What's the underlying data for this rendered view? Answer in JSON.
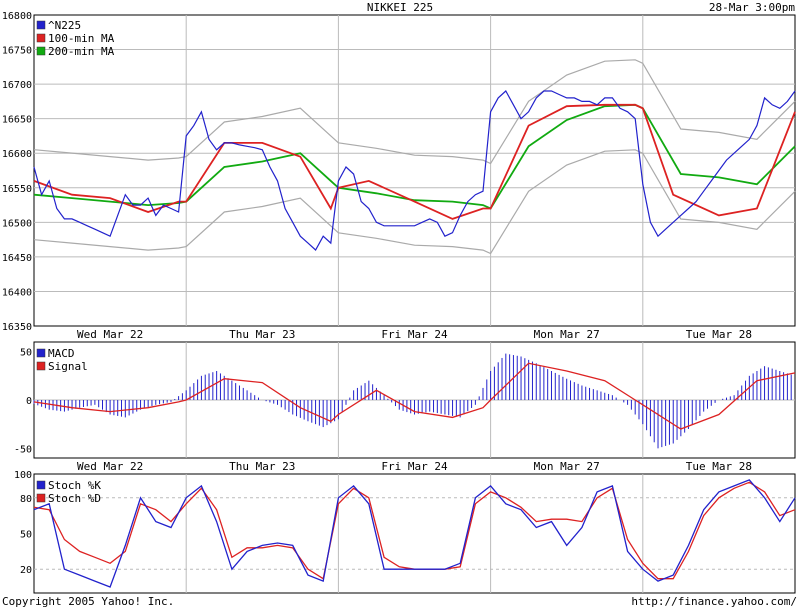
{
  "header": {
    "title": "NIKKEI 225",
    "timestamp": "28-Mar 3:00pm"
  },
  "footer": {
    "copyright": "Copyright 2005 Yahoo! Inc.",
    "url": "http://finance.yahoo.com/"
  },
  "colors": {
    "price": "#2222cc",
    "ma100": "#dd2222",
    "ma200": "#11aa11",
    "bands": "#aaaaaa",
    "grid": "#bbbbbb",
    "macd": "#2222cc",
    "signal": "#dd2222",
    "stochK": "#2222cc",
    "stochD": "#dd2222"
  },
  "chart_data": [
    {
      "type": "line",
      "panel": "price",
      "days": [
        "Wed Mar 22",
        "Thu Mar 23",
        "Fri Mar 24",
        "Mon Mar 27",
        "Tue Mar 28"
      ],
      "ylim": [
        16350,
        16800
      ],
      "yticks": [
        16350,
        16400,
        16450,
        16500,
        16550,
        16600,
        16650,
        16700,
        16750,
        16800
      ],
      "grid": true,
      "legend_position": "top-left",
      "legend": [
        "^N225",
        "100-min MA",
        "200-min MA"
      ],
      "series": [
        {
          "name": "^N225",
          "x": [
            0,
            0.05,
            0.1,
            0.15,
            0.2,
            0.25,
            0.3,
            0.35,
            0.4,
            0.45,
            0.5,
            0.55,
            0.6,
            0.65,
            0.7,
            0.75,
            0.8,
            0.85,
            0.9,
            0.95,
            1.0,
            1.05,
            1.1,
            1.15,
            1.2,
            1.25,
            1.3,
            1.35,
            1.4,
            1.45,
            1.5,
            1.55,
            1.6,
            1.65,
            1.7,
            1.75,
            1.8,
            1.85,
            1.9,
            1.95,
            2.0,
            2.05,
            2.1,
            2.15,
            2.2,
            2.25,
            2.3,
            2.35,
            2.4,
            2.45,
            2.5,
            2.55,
            2.6,
            2.65,
            2.7,
            2.75,
            2.8,
            2.85,
            2.9,
            2.95,
            3.0,
            3.05,
            3.1,
            3.15,
            3.2,
            3.25,
            3.3,
            3.35,
            3.4,
            3.45,
            3.5,
            3.55,
            3.6,
            3.65,
            3.7,
            3.75,
            3.8,
            3.85,
            3.9,
            3.95,
            4.0,
            4.05,
            4.1,
            4.15,
            4.2,
            4.25,
            4.3,
            4.35,
            4.4,
            4.45,
            4.5,
            4.55,
            4.6,
            4.65,
            4.7,
            4.75,
            4.8,
            4.85,
            4.9,
            4.95,
            5.0
          ],
          "values": [
            16580,
            16540,
            16560,
            16520,
            16505,
            16505,
            16500,
            16495,
            16490,
            16485,
            16480,
            16510,
            16540,
            16525,
            16525,
            16535,
            16510,
            16525,
            16520,
            16515,
            16625,
            16640,
            16660,
            16620,
            16605,
            16615,
            16615,
            16612,
            16610,
            16608,
            16605,
            16580,
            16560,
            16520,
            16500,
            16480,
            16470,
            16460,
            16480,
            16470,
            16560,
            16580,
            16570,
            16530,
            16520,
            16500,
            16495,
            16495,
            16495,
            16495,
            16495,
            16500,
            16505,
            16500,
            16480,
            16485,
            16510,
            16530,
            16540,
            16545,
            16660,
            16680,
            16690,
            16670,
            16650,
            16660,
            16680,
            16690,
            16690,
            16685,
            16680,
            16680,
            16675,
            16675,
            16670,
            16680,
            16680,
            16665,
            16660,
            16650,
            16555,
            16500,
            16480,
            16490,
            16500,
            16510,
            16520,
            16530,
            16545,
            16560,
            16575,
            16590,
            16600,
            16610,
            16620,
            16640,
            16680,
            16670,
            16665,
            16675,
            16690
          ]
        },
        {
          "name": "100-min MA",
          "x": [
            0,
            0.25,
            0.5,
            0.75,
            0.95,
            1.0,
            1.25,
            1.5,
            1.75,
            1.95,
            2.0,
            2.2,
            2.5,
            2.75,
            2.95,
            3.0,
            3.25,
            3.5,
            3.75,
            3.95,
            4.0,
            4.2,
            4.5,
            4.75,
            5.0
          ],
          "values": [
            16560,
            16540,
            16535,
            16515,
            16530,
            16530,
            16615,
            16615,
            16595,
            16520,
            16550,
            16560,
            16530,
            16505,
            16520,
            16520,
            16640,
            16668,
            16670,
            16670,
            16665,
            16540,
            16510,
            16520,
            16660
          ]
        },
        {
          "name": "200-min MA",
          "x": [
            0,
            0.25,
            0.5,
            0.75,
            0.95,
            1.0,
            1.25,
            1.5,
            1.75,
            1.95,
            2.0,
            2.25,
            2.5,
            2.75,
            2.95,
            3.0,
            3.25,
            3.5,
            3.75,
            3.95,
            4.0,
            4.25,
            4.5,
            4.75,
            5.0
          ],
          "values": [
            16540,
            16535,
            16530,
            16525,
            16528,
            16530,
            16580,
            16588,
            16600,
            16560,
            16550,
            16542,
            16532,
            16530,
            16525,
            16520,
            16610,
            16648,
            16668,
            16670,
            16665,
            16570,
            16565,
            16555,
            16610
          ]
        }
      ]
    },
    {
      "type": "bar",
      "panel": "macd",
      "ylim": [
        -60,
        60
      ],
      "yticks": [
        -50,
        0,
        50
      ],
      "legend": [
        "MACD",
        "Signal"
      ],
      "series": [
        {
          "name": "MACD",
          "x": [
            0,
            0.1,
            0.2,
            0.3,
            0.4,
            0.5,
            0.6,
            0.7,
            0.8,
            0.9,
            1.0,
            1.1,
            1.2,
            1.3,
            1.4,
            1.5,
            1.6,
            1.7,
            1.8,
            1.9,
            2.0,
            2.1,
            2.2,
            2.3,
            2.4,
            2.5,
            2.6,
            2.7,
            2.8,
            2.9,
            3.0,
            3.1,
            3.2,
            3.3,
            3.4,
            3.5,
            3.6,
            3.7,
            3.8,
            3.9,
            4.0,
            4.1,
            4.2,
            4.3,
            4.4,
            4.5,
            4.6,
            4.7,
            4.8,
            4.9,
            5.0
          ],
          "values": [
            -4,
            -10,
            -12,
            -8,
            -5,
            -15,
            -18,
            -10,
            -5,
            -2,
            10,
            25,
            30,
            20,
            10,
            0,
            -5,
            -15,
            -22,
            -28,
            -20,
            10,
            20,
            5,
            -10,
            -15,
            -12,
            -15,
            -18,
            -5,
            30,
            48,
            45,
            38,
            30,
            22,
            15,
            10,
            5,
            -5,
            -25,
            -50,
            -45,
            -30,
            -12,
            0,
            5,
            25,
            35,
            30,
            25
          ]
        },
        {
          "name": "Signal",
          "x": [
            0,
            0.25,
            0.5,
            0.75,
            0.95,
            1.0,
            1.25,
            1.5,
            1.75,
            1.95,
            2.0,
            2.25,
            2.5,
            2.75,
            2.95,
            3.0,
            3.25,
            3.5,
            3.75,
            3.95,
            4.0,
            4.25,
            4.5,
            4.75,
            5.0
          ],
          "values": [
            -2,
            -8,
            -12,
            -8,
            -2,
            0,
            22,
            18,
            -8,
            -22,
            -15,
            10,
            -12,
            -18,
            -8,
            0,
            38,
            30,
            20,
            0,
            -5,
            -30,
            -15,
            20,
            28
          ]
        }
      ]
    },
    {
      "type": "line",
      "panel": "stochastic",
      "ylim": [
        0,
        100
      ],
      "yticks": [
        20,
        50,
        80,
        100
      ],
      "legend": [
        "Stoch %K",
        "Stoch %D"
      ],
      "series": [
        {
          "name": "Stoch %K",
          "x": [
            0,
            0.1,
            0.2,
            0.3,
            0.4,
            0.5,
            0.6,
            0.7,
            0.8,
            0.9,
            1.0,
            1.1,
            1.2,
            1.3,
            1.4,
            1.5,
            1.6,
            1.7,
            1.8,
            1.9,
            2.0,
            2.1,
            2.2,
            2.3,
            2.4,
            2.5,
            2.6,
            2.7,
            2.8,
            2.9,
            3.0,
            3.1,
            3.2,
            3.3,
            3.4,
            3.5,
            3.6,
            3.7,
            3.8,
            3.9,
            4.0,
            4.1,
            4.2,
            4.3,
            4.4,
            4.5,
            4.6,
            4.7,
            4.8,
            4.9,
            5.0
          ],
          "values": [
            70,
            75,
            20,
            15,
            10,
            5,
            40,
            80,
            60,
            55,
            80,
            90,
            60,
            20,
            35,
            40,
            42,
            40,
            15,
            10,
            80,
            90,
            75,
            20,
            20,
            20,
            20,
            20,
            25,
            80,
            90,
            75,
            70,
            55,
            60,
            40,
            55,
            85,
            90,
            35,
            20,
            10,
            15,
            40,
            70,
            85,
            90,
            95,
            80,
            60,
            80
          ]
        },
        {
          "name": "Stoch %D",
          "x": [
            0,
            0.1,
            0.2,
            0.3,
            0.4,
            0.5,
            0.6,
            0.7,
            0.8,
            0.9,
            1.0,
            1.1,
            1.2,
            1.3,
            1.4,
            1.5,
            1.6,
            1.7,
            1.8,
            1.9,
            2.0,
            2.1,
            2.2,
            2.3,
            2.4,
            2.5,
            2.6,
            2.7,
            2.8,
            2.9,
            3.0,
            3.1,
            3.2,
            3.3,
            3.4,
            3.5,
            3.6,
            3.7,
            3.8,
            3.9,
            4.0,
            4.1,
            4.2,
            4.3,
            4.4,
            4.5,
            4.6,
            4.7,
            4.8,
            4.9,
            5.0
          ],
          "values": [
            72,
            70,
            45,
            35,
            30,
            25,
            35,
            75,
            70,
            60,
            75,
            88,
            70,
            30,
            38,
            38,
            40,
            38,
            20,
            12,
            75,
            88,
            80,
            30,
            22,
            20,
            20,
            20,
            22,
            75,
            85,
            80,
            72,
            60,
            62,
            62,
            60,
            80,
            88,
            45,
            25,
            12,
            12,
            35,
            65,
            80,
            88,
            93,
            85,
            65,
            70
          ]
        }
      ]
    }
  ]
}
